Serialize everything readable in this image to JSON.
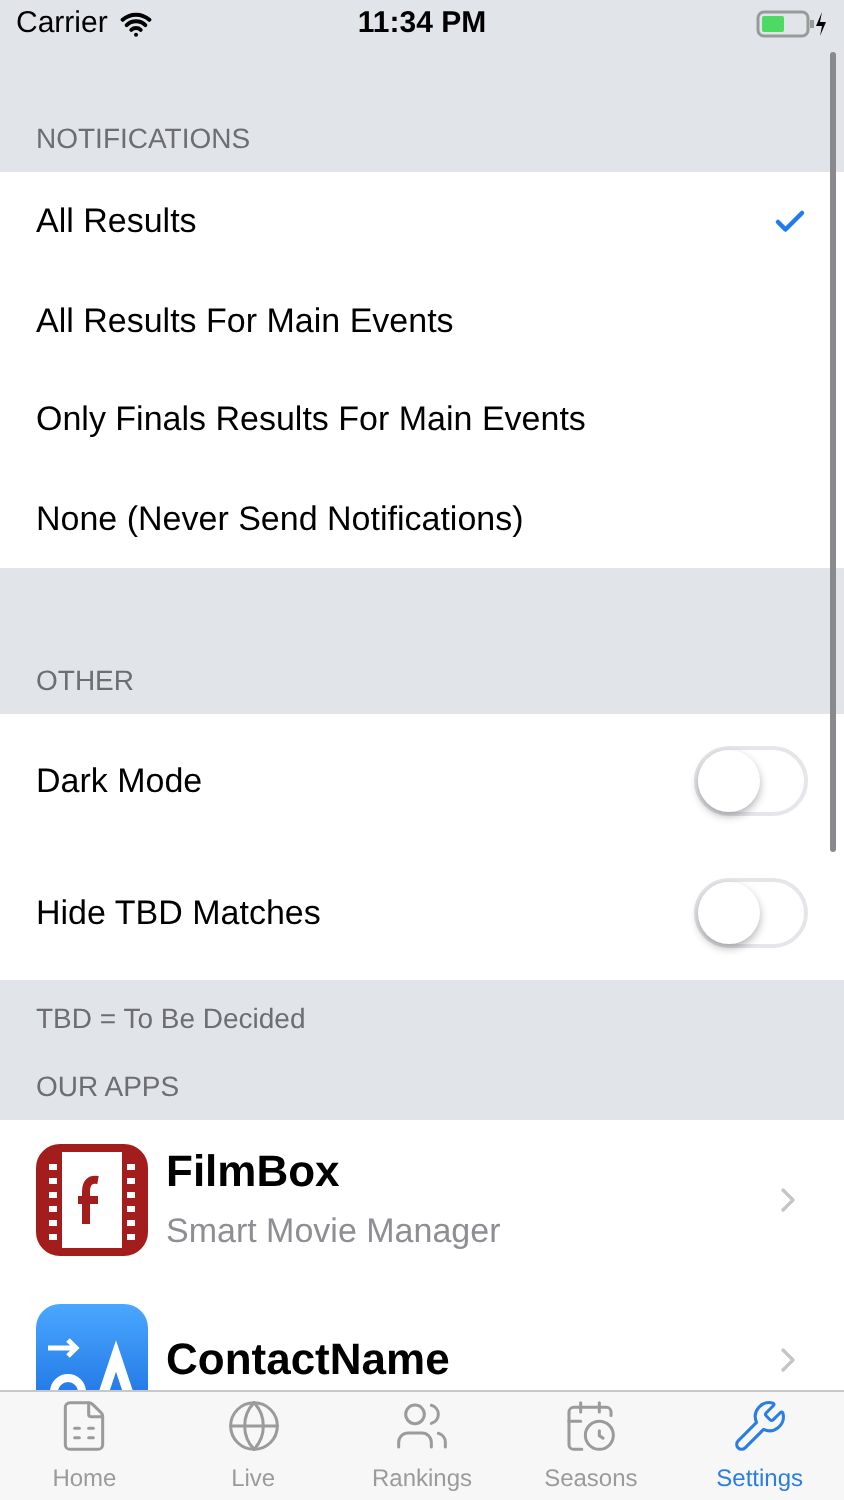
{
  "status_bar": {
    "carrier": "Carrier",
    "time": "11:34 PM"
  },
  "sections": [
    {
      "header": "NOTIFICATIONS",
      "kind": "choices",
      "items": [
        {
          "label": "All Results",
          "selected": true
        },
        {
          "label": "All Results For Main Events",
          "selected": false
        },
        {
          "label": "Only Finals Results For Main Events",
          "selected": false
        },
        {
          "label": "None (Never Send Notifications)",
          "selected": false
        }
      ]
    },
    {
      "header": "OTHER",
      "kind": "toggles",
      "items": [
        {
          "label": "Dark Mode",
          "on": false
        },
        {
          "label": "Hide TBD Matches",
          "on": false
        }
      ],
      "footer": "TBD = To Be Decided"
    },
    {
      "header": "OUR APPS",
      "kind": "apps",
      "items": [
        {
          "title": "FilmBox",
          "subtitle": "Smart Movie Manager"
        },
        {
          "title": "ContactName"
        }
      ]
    }
  ],
  "tab_bar": [
    {
      "label": "Home",
      "selected": false
    },
    {
      "label": "Live",
      "selected": false
    },
    {
      "label": "Rankings",
      "selected": false
    },
    {
      "label": "Seasons",
      "selected": false
    },
    {
      "label": "Settings",
      "selected": true
    }
  ]
}
